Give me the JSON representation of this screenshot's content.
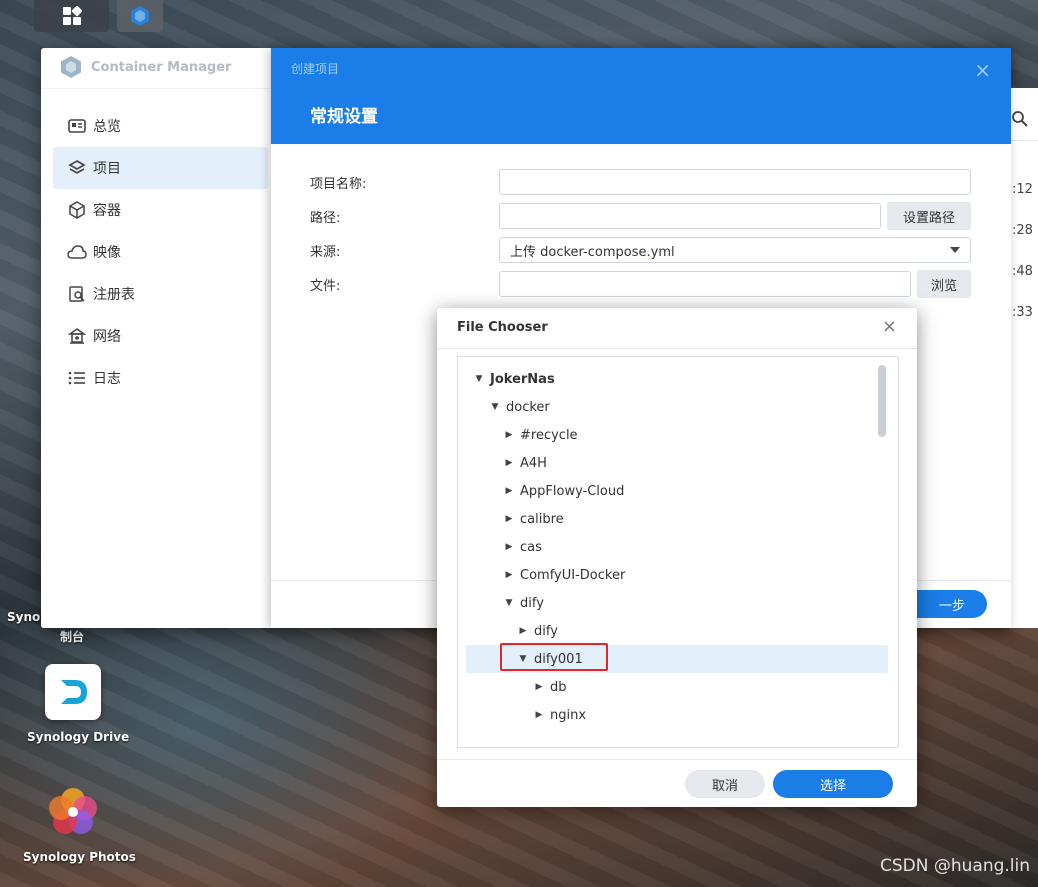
{
  "app": {
    "title": "Container Manager",
    "sidebar": [
      {
        "label": "总览",
        "icon": "overview-icon"
      },
      {
        "label": "项目",
        "icon": "layers-icon",
        "active": true
      },
      {
        "label": "容器",
        "icon": "box-icon"
      },
      {
        "label": "映像",
        "icon": "cloud-icon"
      },
      {
        "label": "注册表",
        "icon": "registry-icon"
      },
      {
        "label": "网络",
        "icon": "network-icon"
      },
      {
        "label": "日志",
        "icon": "list-icon"
      }
    ],
    "right_peek": [
      ":12",
      ":28",
      ":48",
      ":33"
    ]
  },
  "create_dialog": {
    "subtitle": "创建项目",
    "title": "常规设置",
    "close": "×",
    "fields": {
      "name_label": "项目名称:",
      "name_value": "",
      "path_label": "路径:",
      "path_value": "",
      "path_button": "设置路径",
      "source_label": "来源:",
      "source_value": "上传 docker-compose.yml",
      "file_label": "文件:",
      "file_value": "",
      "browse_button": "浏览"
    },
    "next_button": "一步"
  },
  "file_chooser": {
    "title": "File Chooser",
    "close": "×",
    "tree": [
      {
        "label": "JokerNas",
        "depth": 0,
        "expanded": true,
        "bold": true
      },
      {
        "label": "docker",
        "depth": 1,
        "expanded": true
      },
      {
        "label": "#recycle",
        "depth": 2,
        "expanded": false
      },
      {
        "label": "A4H",
        "depth": 2,
        "expanded": false
      },
      {
        "label": "AppFlowy-Cloud",
        "depth": 2,
        "expanded": false
      },
      {
        "label": "calibre",
        "depth": 2,
        "expanded": false
      },
      {
        "label": "cas",
        "depth": 2,
        "expanded": false
      },
      {
        "label": "ComfyUI-Docker",
        "depth": 2,
        "expanded": false
      },
      {
        "label": "dify",
        "depth": 2,
        "expanded": true
      },
      {
        "label": "dify",
        "depth": 3,
        "expanded": false
      },
      {
        "label": "dify001",
        "depth": 3,
        "expanded": true,
        "selected": true
      },
      {
        "label": "db",
        "depth": 4,
        "expanded": false
      },
      {
        "label": "nginx",
        "depth": 4,
        "expanded": false
      }
    ],
    "cancel_button": "取消",
    "choose_button": "选择"
  },
  "desktop": {
    "drive_label": "Synology Drive",
    "photos_label": "Synology Photos",
    "partial_label_1": "Synol",
    "partial_label_2": "制台"
  },
  "watermark": "CSDN @huang.lin",
  "colors": {
    "accent": "#1a7de8",
    "selection": "#e3effa",
    "highlight_box": "#e1262c"
  }
}
